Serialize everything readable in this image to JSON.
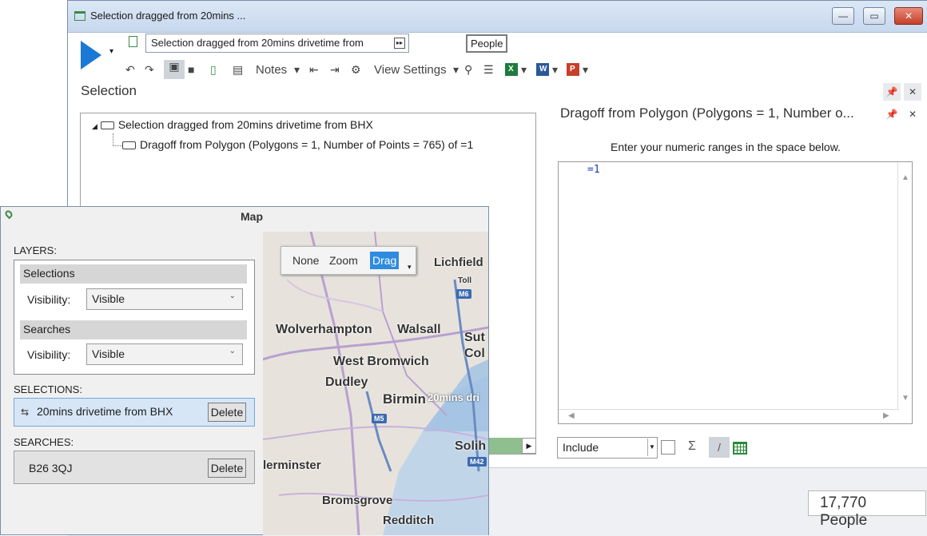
{
  "window": {
    "title": "Selection dragged from 20mins ...",
    "controls": {
      "minimize": "—",
      "maximize": "▭",
      "close": "✕"
    }
  },
  "toolbar": {
    "selection_name": "Selection dragged from 20mins drivetime from",
    "people_chip": "People",
    "notes_label": "Notes",
    "view_settings_label": "View Settings",
    "expand_glyph": "▸▸"
  },
  "selection_panel": {
    "heading": "Selection",
    "tree": {
      "root": "Selection dragged from 20mins drivetime from BHX",
      "child": "Dragoff from Polygon (Polygons = 1, Number of Points = 765) of =1"
    }
  },
  "range_panel": {
    "title": "Dragoff from Polygon (Polygons = 1, Number o...",
    "instructions": "Enter your numeric ranges in the space below.",
    "editor_text": "=1",
    "include_value": "Include",
    "sigma": "Σ",
    "pen": "/"
  },
  "status": {
    "people_count": "17,770 People"
  },
  "map_window": {
    "title": "Map",
    "layers_label": "LAYERS:",
    "layers": [
      {
        "name": "Selections",
        "visibility_label": "Visibility:",
        "visibility": "Visible"
      },
      {
        "name": "Searches",
        "visibility_label": "Visibility:",
        "visibility": "Visible"
      }
    ],
    "selections_label": "SELECTIONS:",
    "selection_item": "20mins drivetime from BHX",
    "searches_label": "SEARCHES:",
    "search_item": "B26 3QJ",
    "delete_label": "Delete",
    "modes": {
      "none": "None",
      "zoom": "Zoom",
      "drag": "Drag"
    },
    "places": {
      "lichfield": "Lichfield",
      "toll": "Toll",
      "m6": "M6",
      "wolverhampton": "Wolverhampton",
      "walsall": "Walsall",
      "sutton": "Sut",
      "coldfield": "Col",
      "west_bromwich": "West Bromwich",
      "dudley": "Dudley",
      "birmingham": "Birmin",
      "overlay_label": "20mins dri",
      "m5": "M5",
      "solihull": "Solih",
      "m42": "M42",
      "kidderminster": "lerminster",
      "bromsgrove": "Bromsgrove",
      "redditch": "Redditch"
    }
  }
}
